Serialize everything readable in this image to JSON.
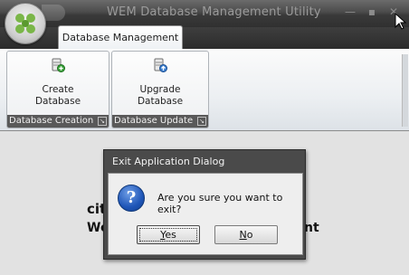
{
  "window": {
    "title": "WEM Database Management Utility",
    "controls": {
      "minimize": "—",
      "maximize": "▪",
      "close": "✕"
    }
  },
  "tabs": [
    {
      "label": "Database Management",
      "active": true
    }
  ],
  "ribbon": {
    "groups": [
      {
        "label": "Database Creation",
        "button_line1": "Create",
        "button_line2": "Database",
        "icon": "database-add-icon"
      },
      {
        "label": "Database Update",
        "button_line1": "Upgrade",
        "button_line2": "Database",
        "icon": "database-upgrade-icon"
      }
    ]
  },
  "background": {
    "brand": "cit",
    "subtitle_left": "Wo",
    "subtitle_right": "nt"
  },
  "dialog": {
    "title": "Exit Application Dialog",
    "icon": "question-icon",
    "icon_glyph": "?",
    "message": "Are you sure you want to exit?",
    "yes_mnemonic": "Y",
    "yes_rest": "es",
    "no_mnemonic": "N",
    "no_rest": "o"
  },
  "colors": {
    "titlebar": "#3a3a3a",
    "dialog_frame": "#4a4a4a",
    "group_label_bg": "#595959"
  }
}
